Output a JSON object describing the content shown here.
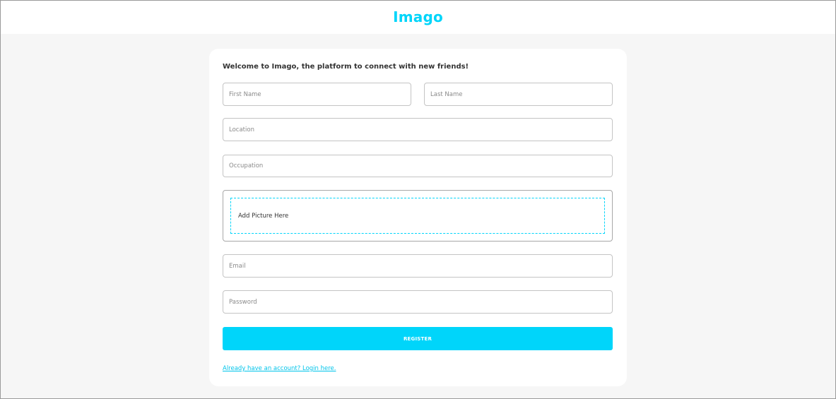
{
  "header": {
    "app_title": "Imago"
  },
  "form": {
    "welcome_text": "Welcome to Imago, the platform to connect with new friends!",
    "first_name": {
      "value": "",
      "placeholder": "First Name"
    },
    "last_name": {
      "value": "",
      "placeholder": "Last Name"
    },
    "location": {
      "value": "",
      "placeholder": "Location"
    },
    "occupation": {
      "value": "",
      "placeholder": "Occupation"
    },
    "picture_dropzone_label": "Add Picture Here",
    "email": {
      "value": "",
      "placeholder": "Email"
    },
    "password": {
      "value": "",
      "placeholder": "Password"
    },
    "register_label": "REGISTER",
    "login_link_text": "Already have an account? Login here."
  },
  "colors": {
    "accent": "#00d5fa",
    "page_background": "#f6f6f6",
    "card_background": "#ffffff",
    "field_border": "#c4c4c4"
  }
}
